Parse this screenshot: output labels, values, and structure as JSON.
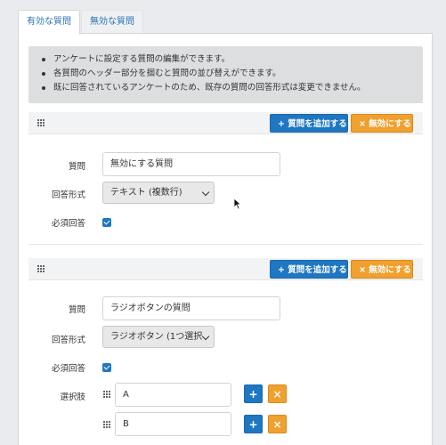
{
  "tabs": [
    {
      "label": "有効な質問",
      "active": true
    },
    {
      "label": "無効な質問",
      "active": false
    }
  ],
  "notice": [
    "アンケートに設定する質問の編集ができます。",
    "各質問のヘッダー部分を掴むと質問の並び替えができます。",
    "既に回答されているアンケートのため、既存の質問の回答形式は変更できません。"
  ],
  "buttons": {
    "add_question": "質問を追加する",
    "disable": "無効にする"
  },
  "icons": {
    "plus": "+",
    "times": "×"
  },
  "labels": {
    "question": "質問",
    "answer_type": "回答形式",
    "required": "必須回答",
    "choices": "選択肢"
  },
  "questions": [
    {
      "question_value": "無効にする質問",
      "answer_type": "テキスト (複数行)",
      "required": true
    },
    {
      "question_value": "ラジオボタンの質問",
      "answer_type": "ラジオボタン (1つ選択",
      "required": true,
      "choices": [
        "A",
        "B"
      ]
    }
  ],
  "colors": {
    "primary": "#1f77c2",
    "warning": "#f0a02e",
    "link": "#2a73b6"
  }
}
